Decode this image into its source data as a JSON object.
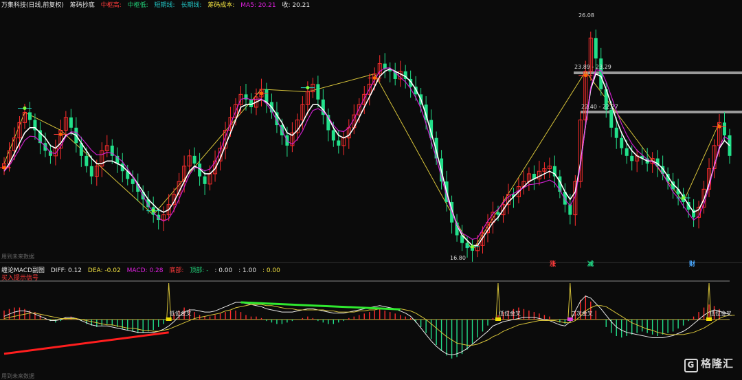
{
  "header": {
    "title": "万集科技(日线,前复权)",
    "indicator": "筹码抄底",
    "mid_label": "中枢高:",
    "fields": [
      "中枢低:",
      "短期线:",
      "长期线:"
    ],
    "field_label": "筹码成本:",
    "ma5_label": "MA5: 20.21",
    "close_label": "收: 20.21"
  },
  "macd_header": {
    "name": "缠论MACD副图",
    "diff": "DIFF: 0.12",
    "dea": "DEA: -0.02",
    "macd": "MACD: 0.28",
    "extra1": "底部:",
    "extra2": "顶部: -",
    "extra3": ": 0.00",
    "extra4": ": 1.00",
    "extra5": ": 0.00",
    "sub": "买入提示信号"
  },
  "footnotes": {
    "top": "用到未来数据",
    "bottom": "用到未来数据"
  },
  "watermark": {
    "mark": "G",
    "text": "格隆汇"
  },
  "markers": {
    "up": "涨",
    "down": "减",
    "buy": "财"
  },
  "colors": {
    "up": "#ff2d2d",
    "down": "#22e08a",
    "ma": "#ffffff",
    "ma2": "#e020e0",
    "zig": "#d8c43a"
  },
  "chart_data": [
    {
      "type": "candlestick",
      "title": "",
      "annotations": {
        "high": "26.08",
        "low": "16.80",
        "zone1": "23.89 - 23.29",
        "zone2": "22.40 - 22.27"
      },
      "closes": [
        20.3,
        20.8,
        21.3,
        21.9,
        22.3,
        22.0,
        21.6,
        21.1,
        20.8,
        20.6,
        20.9,
        21.6,
        22.1,
        21.7,
        21.1,
        20.6,
        20.2,
        19.8,
        20.2,
        20.8,
        21.0,
        20.6,
        20.3,
        20.0,
        19.7,
        19.5,
        19.2,
        18.9,
        18.6,
        18.3,
        18.1,
        18.3,
        18.7,
        19.1,
        19.6,
        20.2,
        20.6,
        20.3,
        19.8,
        19.5,
        19.9,
        20.4,
        20.9,
        21.6,
        22.1,
        22.6,
        23.0,
        22.8,
        22.5,
        22.9,
        23.2,
        22.7,
        22.3,
        21.8,
        21.4,
        21.0,
        21.5,
        22.0,
        22.6,
        23.1,
        23.4,
        22.8,
        22.2,
        21.6,
        21.2,
        21.0,
        21.3,
        21.7,
        22.2,
        22.6,
        23.0,
        23.4,
        23.8,
        24.2,
        24.0,
        23.9,
        23.6,
        23.9,
        23.6,
        23.3,
        23.0,
        22.6,
        22.0,
        21.3,
        20.5,
        19.6,
        18.8,
        18.0,
        17.5,
        17.2,
        17.0,
        16.9,
        17.1,
        17.6,
        18.0,
        18.4,
        18.3,
        18.7,
        19.1,
        19.0,
        19.4,
        19.6,
        19.9,
        19.7,
        20.0,
        20.1,
        20.2,
        19.8,
        19.2,
        18.7,
        18.3,
        19.6,
        22.0,
        23.9,
        25.2,
        24.4,
        23.2,
        22.4,
        21.7,
        21.3,
        20.9,
        20.6,
        20.4,
        20.6,
        20.5,
        20.3,
        20.5,
        20.2,
        19.9,
        19.6,
        19.3,
        19.1,
        18.8,
        18.5,
        18.2,
        18.6,
        19.3,
        20.1,
        21.0,
        21.9,
        21.4,
        20.6
      ],
      "ma_white": [
        20.0,
        20.3,
        20.7,
        21.1,
        21.5,
        21.7,
        21.7,
        21.5,
        21.3,
        21.0,
        20.9,
        21.1,
        21.4,
        21.5,
        21.4,
        21.1,
        20.8,
        20.5,
        20.3,
        20.3,
        20.4,
        20.4,
        20.3,
        20.2,
        20.0,
        19.8,
        19.5,
        19.2,
        18.9,
        18.7,
        18.5,
        18.4,
        18.5,
        18.8,
        19.2,
        19.6,
        20.0,
        20.2,
        20.1,
        19.9,
        19.9,
        20.1,
        20.5,
        21.0,
        21.5,
        22.0,
        22.5,
        22.6,
        22.6,
        22.7,
        22.8,
        22.7,
        22.5,
        22.2,
        21.9,
        21.5,
        21.4,
        21.6,
        21.9,
        22.3,
        22.6,
        22.6,
        22.4,
        22.1,
        21.7,
        21.4,
        21.3,
        21.4,
        21.7,
        22.1,
        22.5,
        22.9,
        23.3,
        23.7,
        23.9,
        24.0,
        23.9,
        23.8,
        23.7,
        23.5,
        23.2,
        22.8,
        22.2,
        21.5,
        20.8,
        20.0,
        19.2,
        18.5,
        17.9,
        17.5,
        17.3,
        17.1,
        17.1,
        17.4,
        17.7,
        18.0,
        18.2,
        18.5,
        18.8,
        19.0,
        19.2,
        19.4,
        19.6,
        19.7,
        19.8,
        19.9,
        20.0,
        19.9,
        19.6,
        19.2,
        18.9,
        19.2,
        20.3,
        21.8,
        23.2,
        23.8,
        23.7,
        23.2,
        22.6,
        22.0,
        21.5,
        21.1,
        20.8,
        20.6,
        20.5,
        20.4,
        20.4,
        20.3,
        20.1,
        19.8,
        19.5,
        19.3,
        19.0,
        18.7,
        18.4,
        18.5,
        18.9,
        19.5,
        20.2,
        20.9,
        21.2,
        21.0
      ]
    },
    {
      "type": "bar",
      "title": "",
      "signal_labels": [
        "低位金叉",
        "低位金叉",
        "二次金叉",
        "低位金叉"
      ],
      "signal_positions": [
        32,
        96,
        110,
        137
      ],
      "values": [
        0.6,
        0.7,
        0.8,
        0.8,
        0.7,
        0.6,
        0.5,
        0.3,
        0.1,
        -0.1,
        -0.2,
        -0.1,
        0.1,
        0.2,
        0.1,
        -0.1,
        -0.3,
        -0.4,
        -0.5,
        -0.4,
        -0.3,
        -0.4,
        -0.5,
        -0.6,
        -0.7,
        -0.8,
        -0.9,
        -0.9,
        -0.8,
        -0.7,
        -0.5,
        -0.3,
        0.1,
        0.4,
        0.6,
        0.8,
        0.7,
        0.5,
        0.3,
        0.2,
        0.2,
        0.3,
        0.4,
        0.5,
        0.6,
        0.6,
        0.5,
        0.3,
        0.2,
        0.2,
        0.1,
        -0.1,
        -0.2,
        -0.3,
        -0.3,
        -0.2,
        -0.1,
        0.0,
        0.1,
        0.2,
        0.1,
        -0.1,
        -0.2,
        -0.3,
        -0.3,
        -0.2,
        -0.1,
        0.1,
        0.2,
        0.3,
        0.4,
        0.5,
        0.6,
        0.7,
        0.6,
        0.5,
        0.4,
        0.3,
        0.2,
        0.1,
        -0.2,
        -0.5,
        -0.9,
        -1.3,
        -1.7,
        -2.1,
        -2.4,
        -2.6,
        -2.5,
        -2.3,
        -2.0,
        -1.6,
        -1.2,
        -0.8,
        -0.4,
        0.1,
        0.3,
        0.5,
        0.6,
        0.7,
        0.8,
        0.7,
        0.6,
        0.5,
        0.4,
        0.3,
        0.2,
        0.0,
        -0.2,
        -0.3,
        -0.1,
        0.6,
        1.3,
        1.6,
        1.2,
        0.6,
        0.0,
        -0.5,
        -0.9,
        -1.1,
        -1.2,
        -1.1,
        -1.0,
        -0.9,
        -0.8,
        -0.9,
        -1.0,
        -1.1,
        -1.0,
        -0.9,
        -0.8,
        -0.6,
        -0.4,
        -0.1,
        0.2,
        0.5,
        0.8,
        1.0,
        0.9,
        0.7
      ],
      "diff": [
        0.3,
        0.5,
        0.7,
        0.8,
        0.8,
        0.7,
        0.5,
        0.3,
        0.1,
        -0.1,
        -0.1,
        0.0,
        0.2,
        0.2,
        0.1,
        -0.1,
        -0.3,
        -0.5,
        -0.6,
        -0.6,
        -0.6,
        -0.7,
        -0.8,
        -0.9,
        -1.0,
        -1.1,
        -1.2,
        -1.2,
        -1.2,
        -1.2,
        -1.1,
        -0.9,
        -0.6,
        -0.2,
        0.3,
        0.7,
        0.9,
        0.9,
        0.8,
        0.7,
        0.7,
        0.8,
        1.0,
        1.2,
        1.4,
        1.6,
        1.6,
        1.5,
        1.4,
        1.3,
        1.2,
        1.0,
        0.9,
        0.8,
        0.7,
        0.7,
        0.7,
        0.8,
        0.9,
        1.0,
        1.0,
        0.9,
        0.8,
        0.7,
        0.6,
        0.6,
        0.6,
        0.7,
        0.8,
        0.9,
        1.0,
        1.1,
        1.2,
        1.3,
        1.2,
        1.1,
        1.0,
        0.8,
        0.6,
        0.3,
        -0.2,
        -0.8,
        -1.4,
        -2.0,
        -2.5,
        -2.9,
        -3.2,
        -3.3,
        -3.2,
        -3.0,
        -2.7,
        -2.3,
        -1.9,
        -1.5,
        -1.1,
        -0.6,
        -0.4,
        -0.2,
        -0.1,
        0.0,
        0.1,
        0.2,
        0.2,
        0.2,
        0.1,
        0.0,
        -0.1,
        -0.3,
        -0.5,
        -0.6,
        -0.2,
        0.8,
        1.7,
        2.2,
        2.0,
        1.5,
        1.0,
        0.4,
        -0.2,
        -0.7,
        -1.0,
        -1.2,
        -1.3,
        -1.4,
        -1.5,
        -1.6,
        -1.7,
        -1.7,
        -1.7,
        -1.6,
        -1.5,
        -1.3,
        -1.1,
        -0.8,
        -0.4,
        0.0,
        0.4,
        0.7,
        0.9,
        0.8,
        0.6,
        0.5
      ],
      "dea": [
        0.1,
        0.2,
        0.3,
        0.4,
        0.5,
        0.6,
        0.6,
        0.5,
        0.4,
        0.3,
        0.2,
        0.1,
        0.1,
        0.1,
        0.1,
        0.0,
        -0.1,
        -0.2,
        -0.3,
        -0.4,
        -0.5,
        -0.5,
        -0.6,
        -0.7,
        -0.8,
        -0.8,
        -0.9,
        -1.0,
        -1.0,
        -1.1,
        -1.1,
        -1.0,
        -0.9,
        -0.7,
        -0.5,
        -0.3,
        -0.1,
        0.1,
        0.2,
        0.3,
        0.4,
        0.5,
        0.6,
        0.8,
        0.9,
        1.1,
        1.2,
        1.3,
        1.4,
        1.4,
        1.4,
        1.3,
        1.3,
        1.2,
        1.1,
        1.0,
        1.0,
        0.9,
        0.9,
        0.9,
        0.9,
        0.9,
        0.9,
        0.8,
        0.8,
        0.7,
        0.7,
        0.7,
        0.7,
        0.8,
        0.8,
        0.9,
        0.9,
        1.0,
        1.0,
        1.0,
        1.0,
        1.0,
        0.9,
        0.8,
        0.6,
        0.3,
        0.0,
        -0.4,
        -0.8,
        -1.2,
        -1.6,
        -1.9,
        -2.2,
        -2.3,
        -2.4,
        -2.4,
        -2.3,
        -2.1,
        -1.9,
        -1.6,
        -1.4,
        -1.1,
        -0.9,
        -0.7,
        -0.5,
        -0.4,
        -0.3,
        -0.2,
        -0.1,
        -0.1,
        -0.1,
        -0.1,
        -0.2,
        -0.3,
        -0.3,
        -0.1,
        0.3,
        0.8,
        1.1,
        1.3,
        1.3,
        1.2,
        0.9,
        0.6,
        0.3,
        0.0,
        -0.3,
        -0.5,
        -0.7,
        -0.9,
        -1.0,
        -1.2,
        -1.3,
        -1.4,
        -1.4,
        -1.4,
        -1.4,
        -1.3,
        -1.2,
        -1.0,
        -0.8,
        -0.5,
        -0.2,
        0.1,
        0.3,
        0.4,
        0.4
      ]
    }
  ]
}
